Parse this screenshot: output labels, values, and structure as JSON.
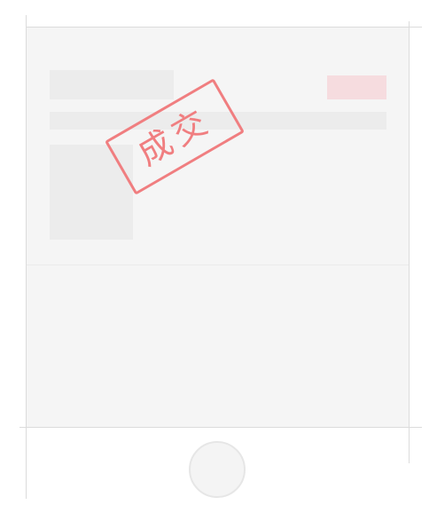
{
  "stamp": {
    "text": "成交",
    "color": "#f07e80"
  },
  "skeleton": {
    "badge_color": "#f6dcdf",
    "block_color": "#ececec",
    "screen_color": "#f5f5f5"
  }
}
